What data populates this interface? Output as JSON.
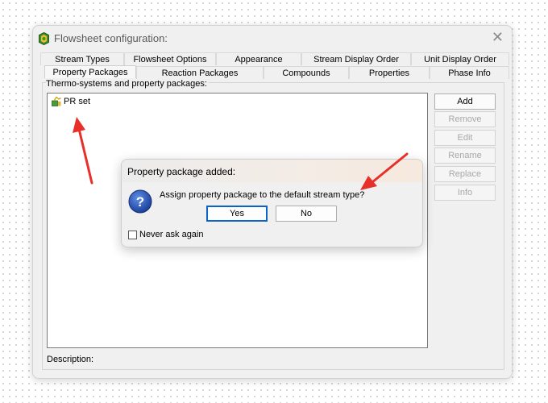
{
  "window": {
    "title": "Flowsheet configuration:",
    "tabs_row1": [
      "Stream Types",
      "Flowsheet Options",
      "Appearance",
      "Stream Display Order",
      "Unit Display Order"
    ],
    "tabs_row2": [
      "Property Packages",
      "Reaction Packages",
      "Compounds",
      "Properties",
      "Phase Info"
    ],
    "group_label": "Thermo-systems and property packages:",
    "list_items": [
      "PR set"
    ],
    "buttons": {
      "add": "Add",
      "remove": "Remove",
      "edit": "Edit",
      "rename": "Rename",
      "replace": "Replace",
      "info": "Info"
    },
    "description_label": "Description:"
  },
  "dialog": {
    "title": "Property package added:",
    "message": "Assign property package to the default stream type?",
    "yes": "Yes",
    "no": "No",
    "checkbox_label": "Never ask again",
    "checkbox_checked": false
  },
  "colors": {
    "annotation_arrow": "#e8302a",
    "default_button_border": "#0a64c8"
  }
}
